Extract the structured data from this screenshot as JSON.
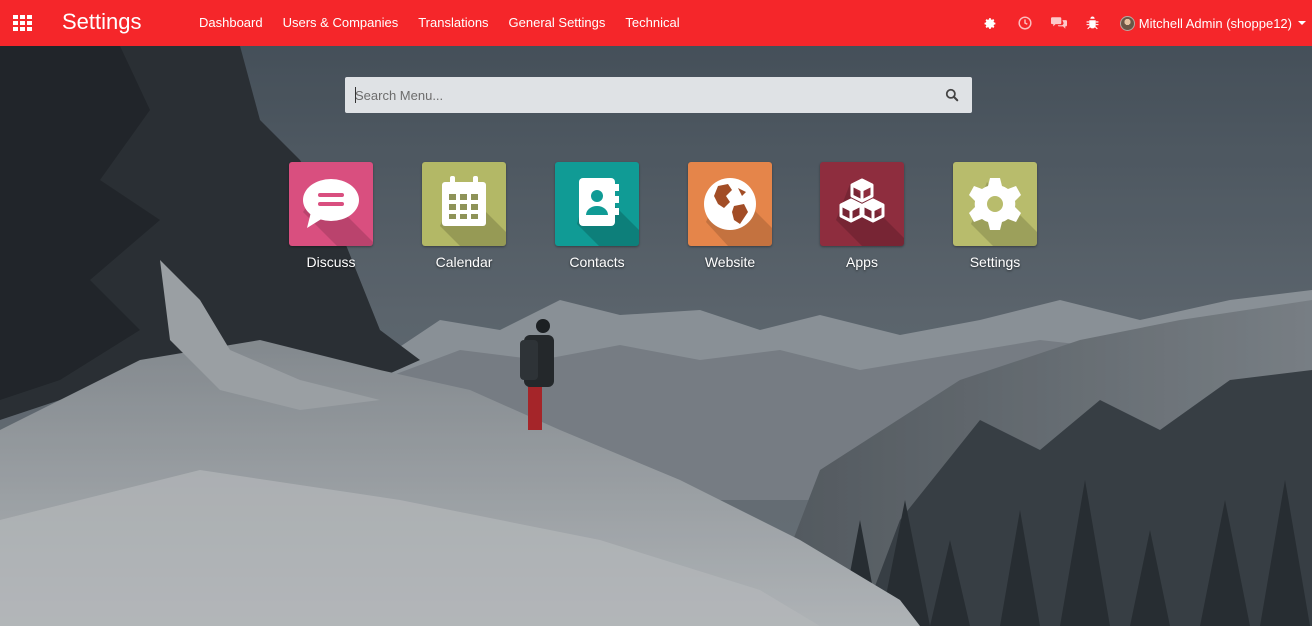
{
  "navbar": {
    "brand": "Settings",
    "menu": [
      "Dashboard",
      "Users & Companies",
      "Translations",
      "General Settings",
      "Technical"
    ],
    "user": "Mitchell Admin (shoppe12)",
    "color": "#f5262a"
  },
  "search": {
    "placeholder": "Search Menu...",
    "value": ""
  },
  "apps": [
    {
      "label": "Discuss",
      "icon": "chat-bubble-icon",
      "color": "#d94f7f"
    },
    {
      "label": "Calendar",
      "icon": "calendar-icon",
      "color": "#b3b866"
    },
    {
      "label": "Contacts",
      "icon": "address-book-icon",
      "color": "#109b95"
    },
    {
      "label": "Website",
      "icon": "globe-icon",
      "color": "#e5854a"
    },
    {
      "label": "Apps",
      "icon": "cubes-icon",
      "color": "#8e2d3e"
    },
    {
      "label": "Settings",
      "icon": "gear-icon",
      "color": "#b8bc6c"
    }
  ]
}
